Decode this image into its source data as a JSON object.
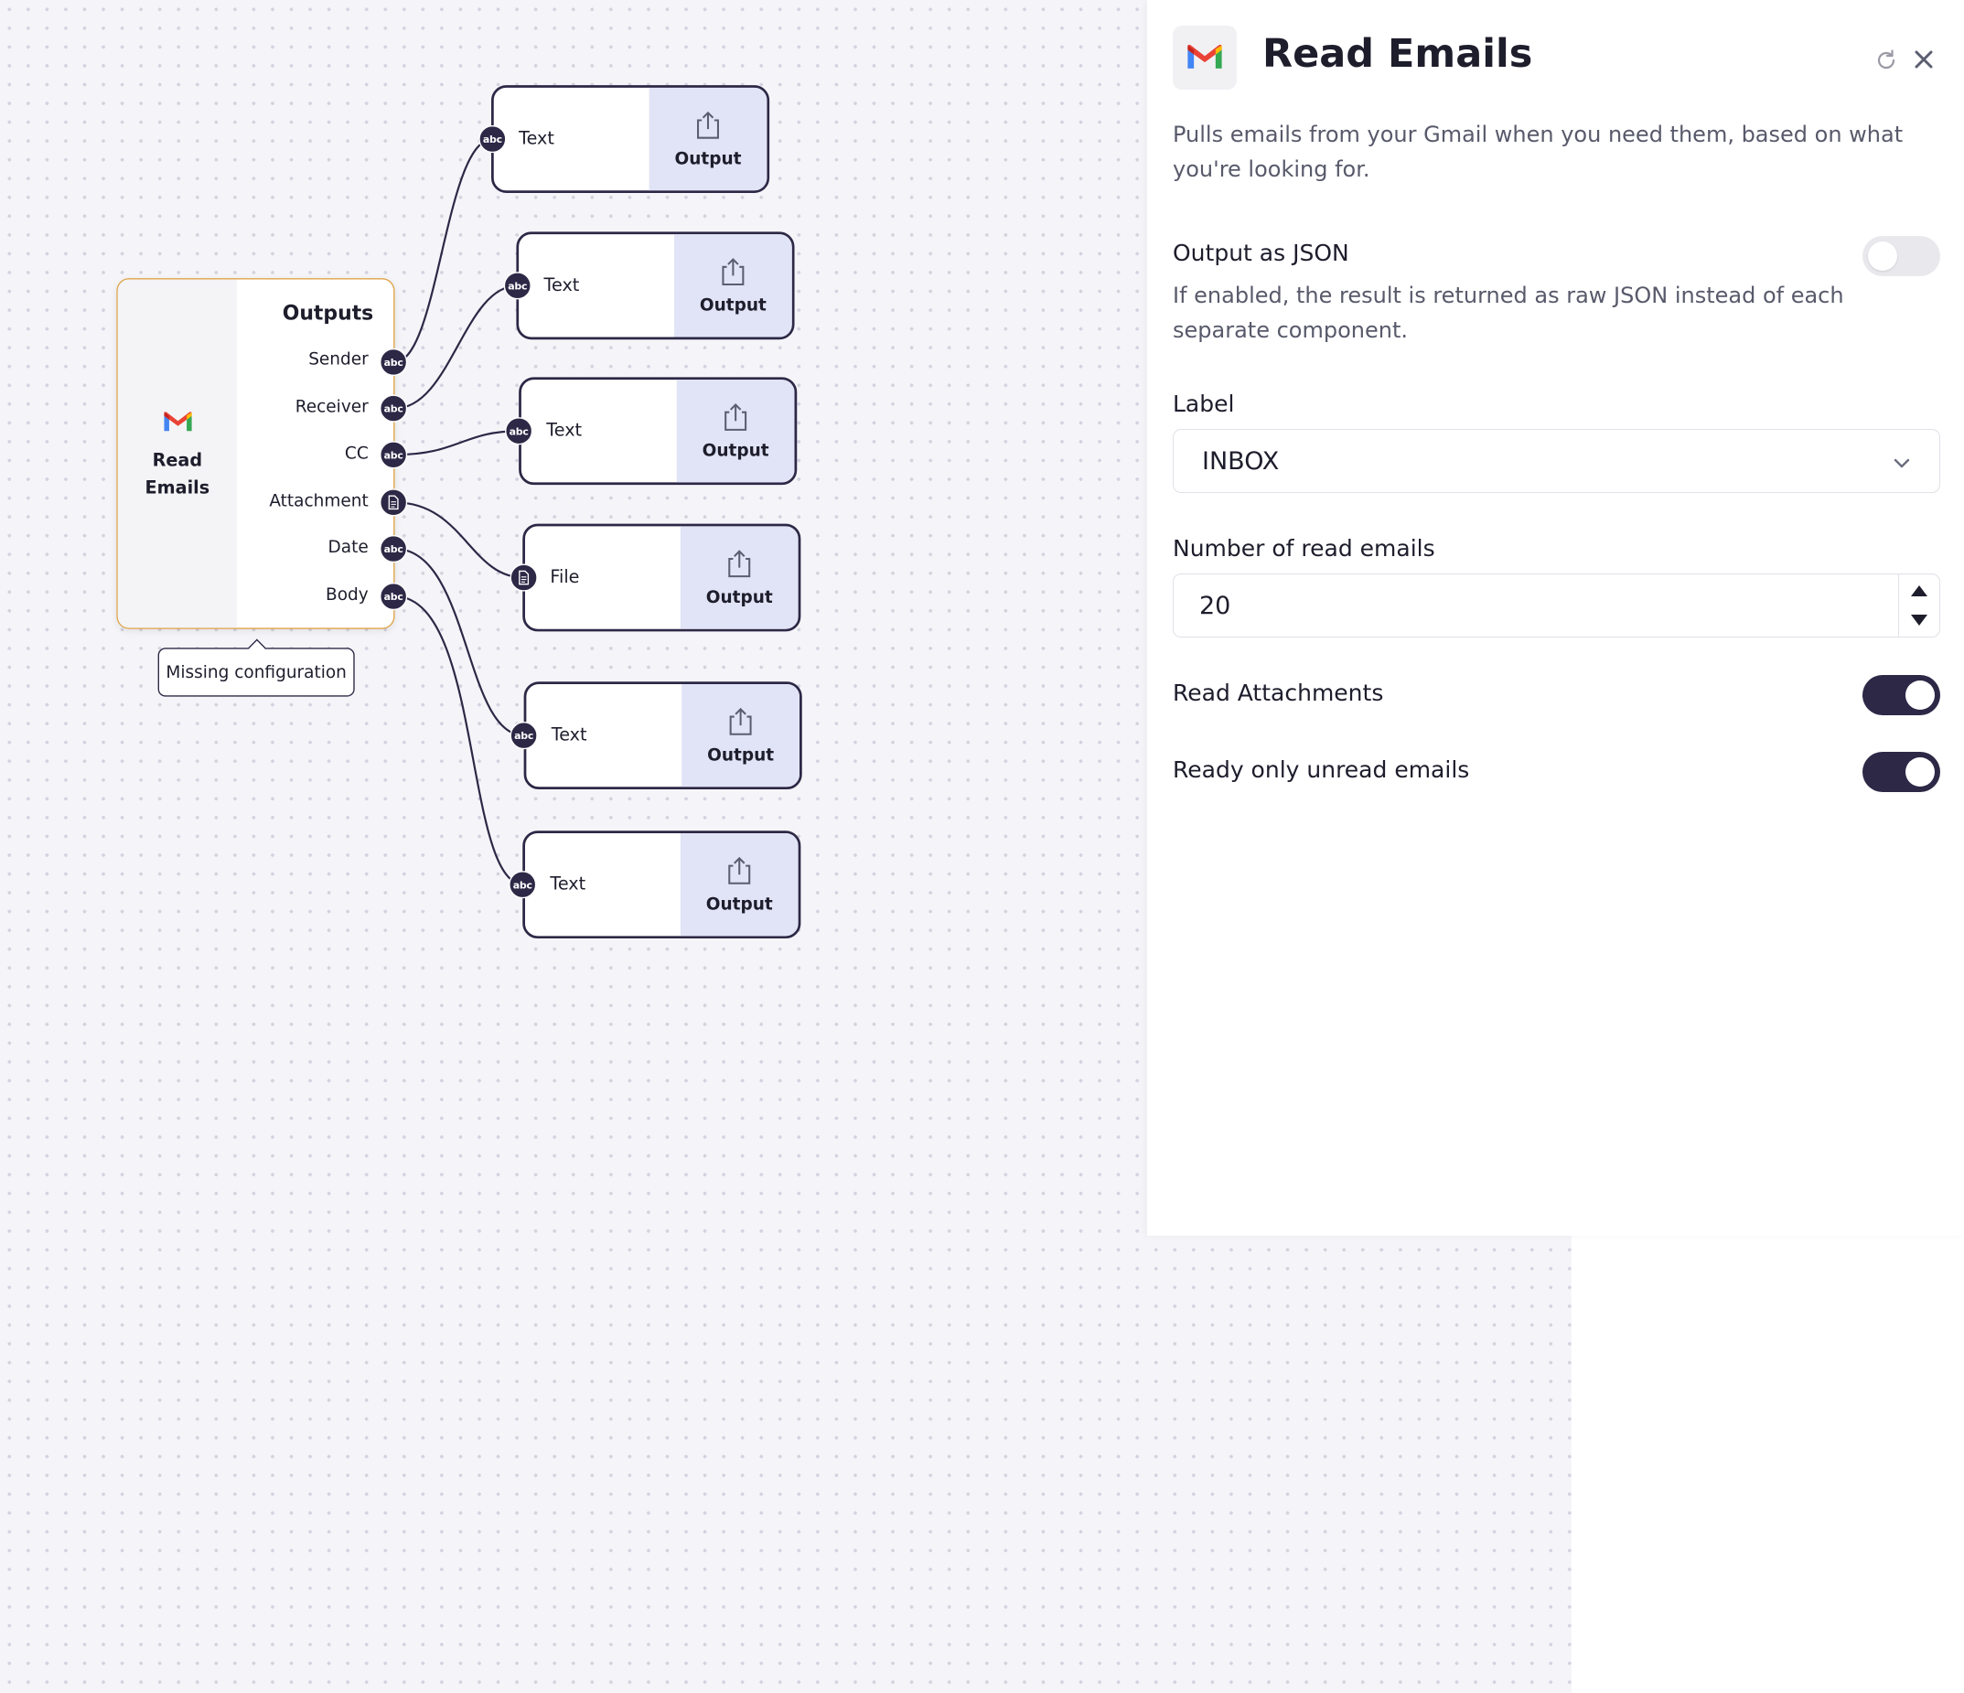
{
  "canvas": {
    "source_node": {
      "name": "Read Emails",
      "outputs_title": "Outputs",
      "outputs": [
        {
          "label": "Sender",
          "port": "abc"
        },
        {
          "label": "Receiver",
          "port": "abc"
        },
        {
          "label": "CC",
          "port": "abc"
        },
        {
          "label": "Attachment",
          "port": "file-icon"
        },
        {
          "label": "Date",
          "port": "abc"
        },
        {
          "label": "Body",
          "port": "abc"
        }
      ],
      "tooltip": "Missing configuration"
    },
    "output_nodes": [
      {
        "input_label": "Text",
        "port": "abc",
        "title": "Output"
      },
      {
        "input_label": "Text",
        "port": "abc",
        "title": "Output"
      },
      {
        "input_label": "Text",
        "port": "abc",
        "title": "Output"
      },
      {
        "input_label": "File",
        "port": "file-icon",
        "title": "Output"
      },
      {
        "input_label": "Text",
        "port": "abc",
        "title": "Output"
      },
      {
        "input_label": "Text",
        "port": "abc",
        "title": "Output"
      }
    ]
  },
  "panel": {
    "title": "Read Emails",
    "description": "Pulls emails from your Gmail when you need them, based on what you're looking for.",
    "output_json": {
      "label": "Output as JSON",
      "help": "If enabled, the result is returned as raw JSON instead of each separate component.",
      "enabled": false
    },
    "label_field": {
      "label": "Label",
      "value": "INBOX"
    },
    "number_field": {
      "label": "Number of read emails",
      "value": "20"
    },
    "read_attachments": {
      "label": "Read Attachments",
      "enabled": true
    },
    "unread_only": {
      "label": "Ready only unread emails",
      "enabled": true
    }
  },
  "colors": {
    "accent": "#2d2846",
    "node_border_warning": "#e0a44a",
    "output_panel": "#e1e4f6",
    "gmail_red": "#ea4335",
    "gmail_blue": "#4285f4",
    "gmail_green": "#34a853",
    "gmail_yellow": "#fbbc04"
  }
}
